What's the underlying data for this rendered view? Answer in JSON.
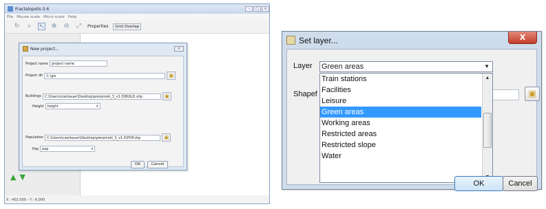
{
  "app": {
    "title": "Fractalopolis 0.6",
    "menu": [
      "File",
      "Mouse scale",
      "Micro scale",
      "Help"
    ],
    "toolbar": {
      "properties_label": "Properties",
      "grid_label": "Grid",
      "overlap_label": "Overlap"
    },
    "status": "X : 402.000 - Y : 6.000"
  },
  "new_project": {
    "title": "New project...",
    "project_name_label": "Project name",
    "project_name_value": "project name",
    "project_dir_label": "Project dir",
    "project_dir_value": "C:\\gis",
    "buildings_label": "Buildings",
    "buildings_value": "C:\\Users\\czerkauer\\Desktop\\pierpinski_3_v1.0\\BUILD.shp",
    "height_label": "Height",
    "height_value": "height",
    "population_label": "Population",
    "population_value": "C:\\Users\\czerkauer\\Desktop\\pierpinski_3_v1.0\\POP.shp",
    "pop_label": "Pop",
    "pop_value": "pop",
    "ok_label": "OK",
    "cancel_label": "Cancel"
  },
  "set_layer": {
    "title": "Set layer...",
    "close_label": "X",
    "layer_label": "Layer",
    "selected_layer": "Green areas",
    "shapefile_label": "Shapef",
    "options": [
      "Train stations",
      "Facilities",
      "Leisure",
      "Green areas",
      "Working areas",
      "Restricted areas",
      "Restricted slope",
      "Water"
    ],
    "selected_index": 3,
    "ok_label": "OK",
    "cancel_label": "Cancel"
  }
}
